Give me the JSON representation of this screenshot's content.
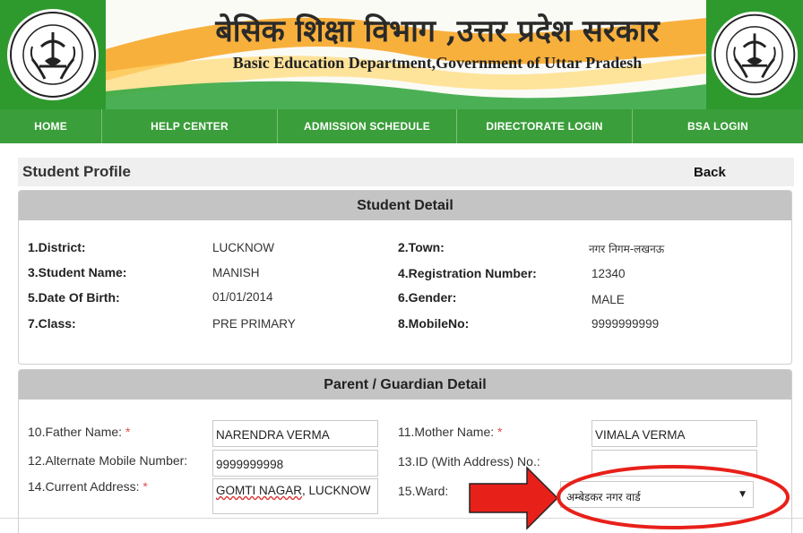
{
  "header": {
    "title_hindi": "बेसिक शिक्षा विभाग ,उत्तर प्रदेश सरकार",
    "title_english": "Basic Education Department,Government of Uttar Pradesh",
    "emblem_text": "उत्तर प्रदेश सरकार"
  },
  "nav": {
    "items": [
      {
        "label": "HOME"
      },
      {
        "label": "HELP CENTER"
      },
      {
        "label": "ADMISSION SCHEDULE"
      },
      {
        "label": "DIRECTORATE LOGIN"
      },
      {
        "label": "BSA LOGIN"
      }
    ]
  },
  "profile": {
    "title": "Student Profile",
    "back_label": "Back"
  },
  "student": {
    "heading": "Student Detail",
    "fields": [
      {
        "label": "1.District:",
        "value": "LUCKNOW"
      },
      {
        "label": "2.Town:",
        "value": "नगर निगम-लखनऊ"
      },
      {
        "label": "3.Student Name:",
        "value": "MANISH"
      },
      {
        "label": "4.Registration Number:",
        "value": "12340"
      },
      {
        "label": "5.Date Of Birth:",
        "value": "01/01/2014"
      },
      {
        "label": "6.Gender:",
        "value": "MALE"
      },
      {
        "label": "7.Class:",
        "value": "PRE PRIMARY"
      },
      {
        "label": "8.MobileNo:",
        "value": "9999999999"
      }
    ]
  },
  "parent": {
    "heading": "Parent / Guardian Detail",
    "required_mark": "*",
    "father": {
      "label": "10.Father Name:",
      "value": "NARENDRA VERMA"
    },
    "mother": {
      "label": "11.Mother Name:",
      "value": "VIMALA VERMA"
    },
    "alt_mobile": {
      "label": "12.Alternate Mobile Number:",
      "value": "9999999998"
    },
    "id_no": {
      "label": "13.ID (With Address) No.:",
      "value": ""
    },
    "address": {
      "label": "14.Current Address:",
      "value_part1": "GOMTI NAGAR",
      "value_part2": ", LUCKNOW"
    },
    "ward": {
      "label": "15.Ward:",
      "selected": "अम्बेडकर नगर वार्ड"
    }
  },
  "annotation": {
    "arrow_color": "#e8201a",
    "circle_color": "#e8201a"
  },
  "colors": {
    "nav_green": "#3a9e3a",
    "logo_green": "#2e9a2e",
    "panel_head": "#c4c4c4"
  }
}
